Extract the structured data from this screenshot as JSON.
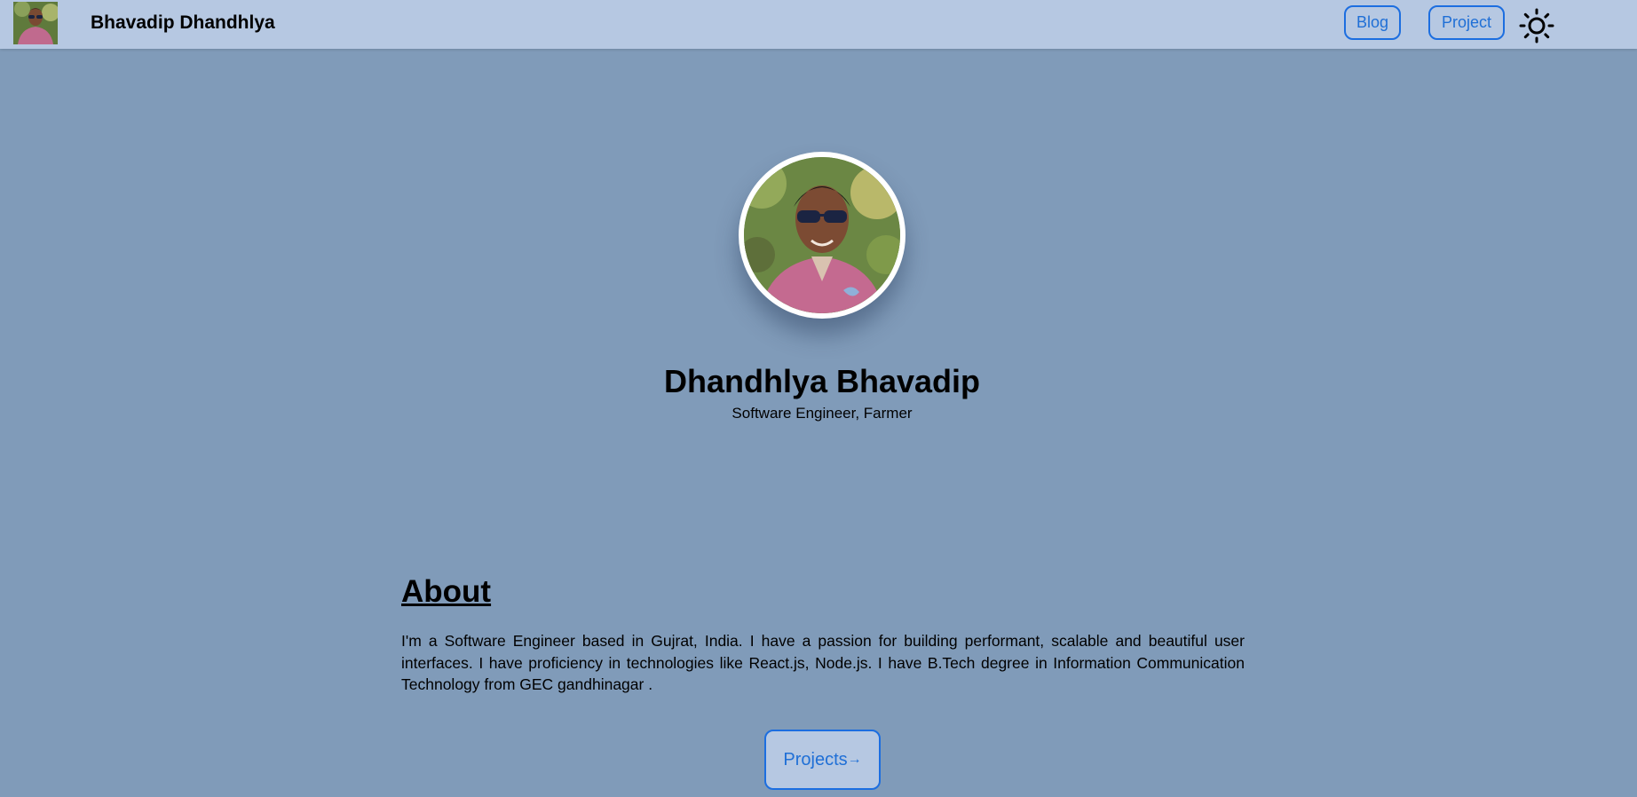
{
  "navbar": {
    "title": "Bhavadip Dhandhlya",
    "blog_label": "Blog",
    "project_label": "Project",
    "theme_icon": "sun-icon"
  },
  "hero": {
    "name": "Dhandhlya Bhavadip",
    "subtitle": "Software Engineer, Farmer"
  },
  "about": {
    "heading": "About",
    "text": "I'm a Software Engineer based in Gujrat, India. I have a passion for building performant, scalable and beautiful user interfaces. I have proficiency in technologies like React.js, Node.js. I have B.Tech degree in Information Communication Technology from GEC gandhinagar ."
  },
  "cta": {
    "projects_label": "Projects",
    "arrow": "→"
  },
  "colors": {
    "page_bg": "#809bb9",
    "navbar_bg": "#b6c8e2",
    "accent": "#1c6ee0"
  }
}
